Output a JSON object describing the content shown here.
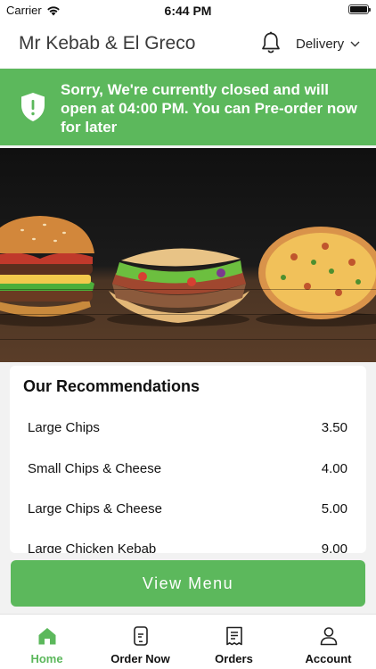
{
  "status_bar": {
    "carrier": "Carrier",
    "time": "6:44 PM"
  },
  "header": {
    "title": "Mr Kebab & El Greco",
    "delivery_mode": "Delivery"
  },
  "banner": {
    "message": "Sorry, We're currently closed and will open at 04:00 PM. You can Pre-order now for later"
  },
  "recommendations": {
    "title": "Our Recommendations",
    "items": [
      {
        "name": "Large Chips",
        "price": "3.50"
      },
      {
        "name": "Small Chips & Cheese",
        "price": "4.00"
      },
      {
        "name": "Large Chips & Cheese",
        "price": "5.00"
      },
      {
        "name": "Large Chicken Kebab",
        "price": "9.00"
      }
    ]
  },
  "view_menu_label": "View Menu",
  "tabs": [
    {
      "label": "Home",
      "icon": "home-icon",
      "active": true
    },
    {
      "label": "Order Now",
      "icon": "order-icon",
      "active": false
    },
    {
      "label": "Orders",
      "icon": "receipt-icon",
      "active": false
    },
    {
      "label": "Account",
      "icon": "person-icon",
      "active": false
    }
  ],
  "colors": {
    "accent": "#5cb85c",
    "hero_dark": "#101010",
    "wood": "#5a3d28"
  }
}
